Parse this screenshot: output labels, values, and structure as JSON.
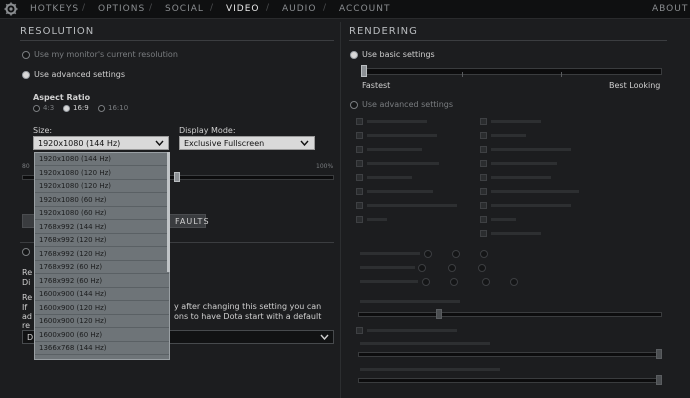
{
  "nav": {
    "items": [
      "HOTKEYS",
      "OPTIONS",
      "SOCIAL",
      "VIDEO",
      "AUDIO",
      "ACCOUNT"
    ],
    "active": "VIDEO",
    "about": "ABOUT"
  },
  "resolution": {
    "title": "RESOLUTION",
    "monitor_option": "Use my monitor's current resolution",
    "advanced_option": "Use advanced settings",
    "aspect_label": "Aspect Ratio",
    "aspect_options": [
      "4:3",
      "16:9",
      "16:10"
    ],
    "aspect_selected": "16:9",
    "size_label": "Size:",
    "size_value": "1920x1080 (144 Hz)",
    "display_mode_label": "Display Mode:",
    "display_mode_value": "Exclusive Fullscreen",
    "slider_min": "80",
    "slider_max": "100%",
    "defaults_fragment": "FAULTS",
    "partial_lines": [
      "Re",
      "Di",
      "Re",
      "If"
    ],
    "warning_fragment_1": "y after changing this setting you can",
    "warning_fragment_2": "ons to have Dota start with a default",
    "partial_prefix_1": "ad",
    "partial_prefix_2": "re",
    "bottom_select_prefix": "D",
    "dropdown_options": [
      "1920x1080 (144 Hz)",
      "1920x1080 (120 Hz)",
      "1920x1080 (120 Hz)",
      "1920x1080 (60 Hz)",
      "1920x1080 (60 Hz)",
      "1768x992 (144 Hz)",
      "1768x992 (120 Hz)",
      "1768x992 (120 Hz)",
      "1768x992 (60 Hz)",
      "1768x992 (60 Hz)",
      "1600x900 (144 Hz)",
      "1600x900 (120 Hz)",
      "1600x900 (120 Hz)",
      "1600x900 (60 Hz)",
      "1366x768 (144 Hz)"
    ]
  },
  "rendering": {
    "title": "RENDERING",
    "basic_option": "Use basic settings",
    "quality_min": "Fastest",
    "quality_max": "Best Looking",
    "advanced_option": "Use advanced settings"
  }
}
